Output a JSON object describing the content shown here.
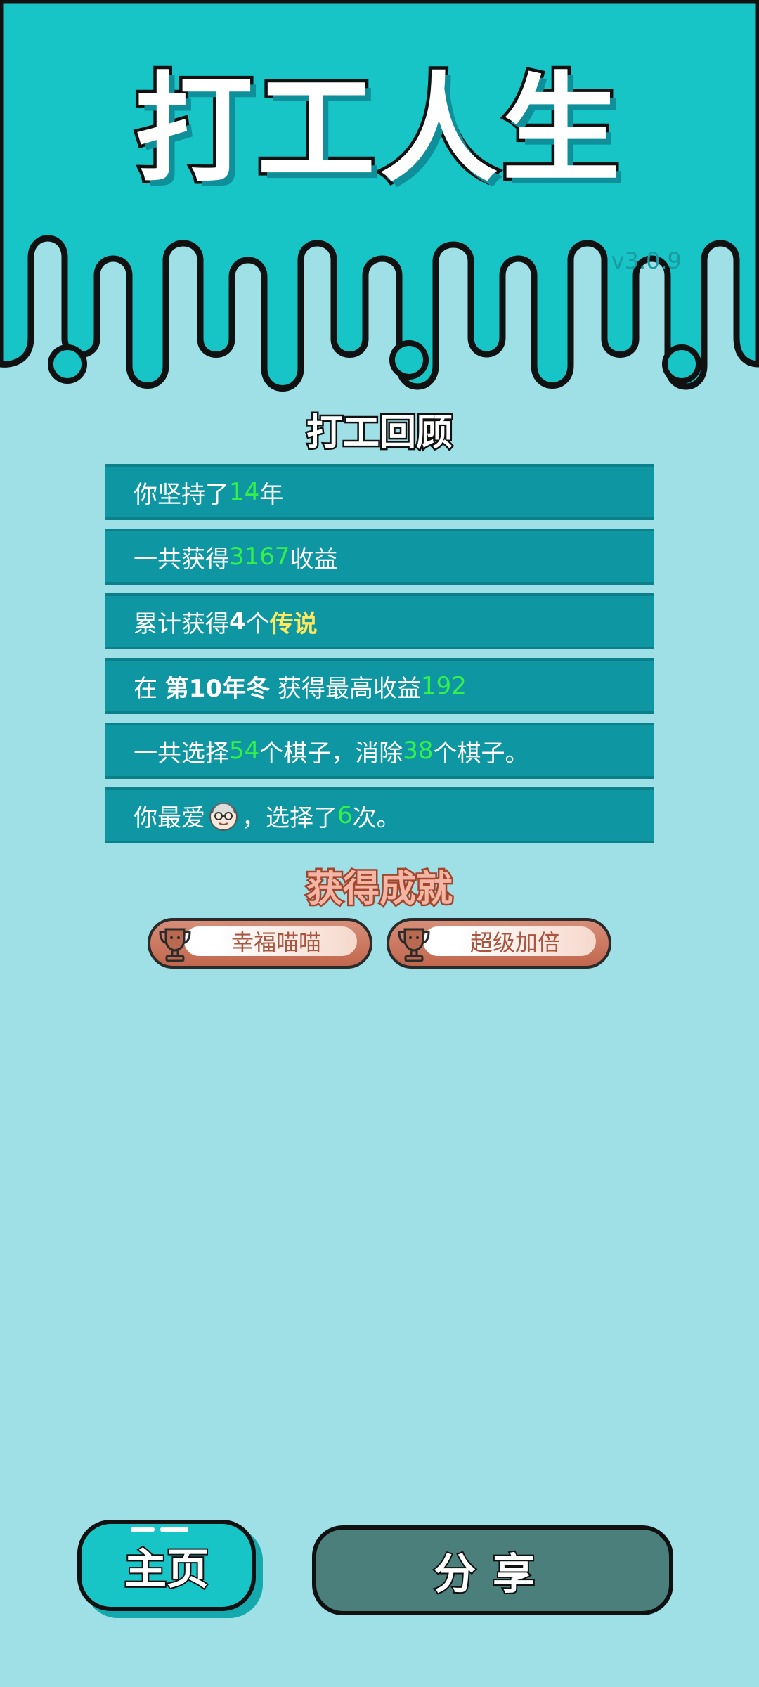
{
  "header": {
    "title": "打工人生",
    "version": "v3.0.9"
  },
  "review": {
    "title": "打工回顾",
    "rows": [
      {
        "a": "你坚持了",
        "b": "14",
        "c": "年"
      },
      {
        "a": "一共获得",
        "b": "3167",
        "c": "收益"
      },
      {
        "a": "累计获得",
        "b": "4",
        "c": "个",
        "d": "传说"
      },
      {
        "a": "在 ",
        "b": "第10年冬",
        "c": " 获得最高收益",
        "d": "192"
      },
      {
        "a": "一共选择",
        "b": "54",
        "c": "个棋子，消除",
        "d": "38",
        "e": "个棋子。"
      },
      {
        "a": "你最爱",
        "b": "，选择了",
        "c": "6",
        "d": "次。"
      }
    ]
  },
  "achievements": {
    "title": "获得成就",
    "items": [
      "幸福喵喵",
      "超级加倍"
    ]
  },
  "buttons": {
    "home": "主页",
    "share": "分享"
  },
  "colors": {
    "top_bg": "#17c5c7",
    "page_bg": "#9fdfe6",
    "row_bg": "#0e97a3",
    "highlight_green": "#35f04a",
    "highlight_yellow": "#ffe95a"
  }
}
